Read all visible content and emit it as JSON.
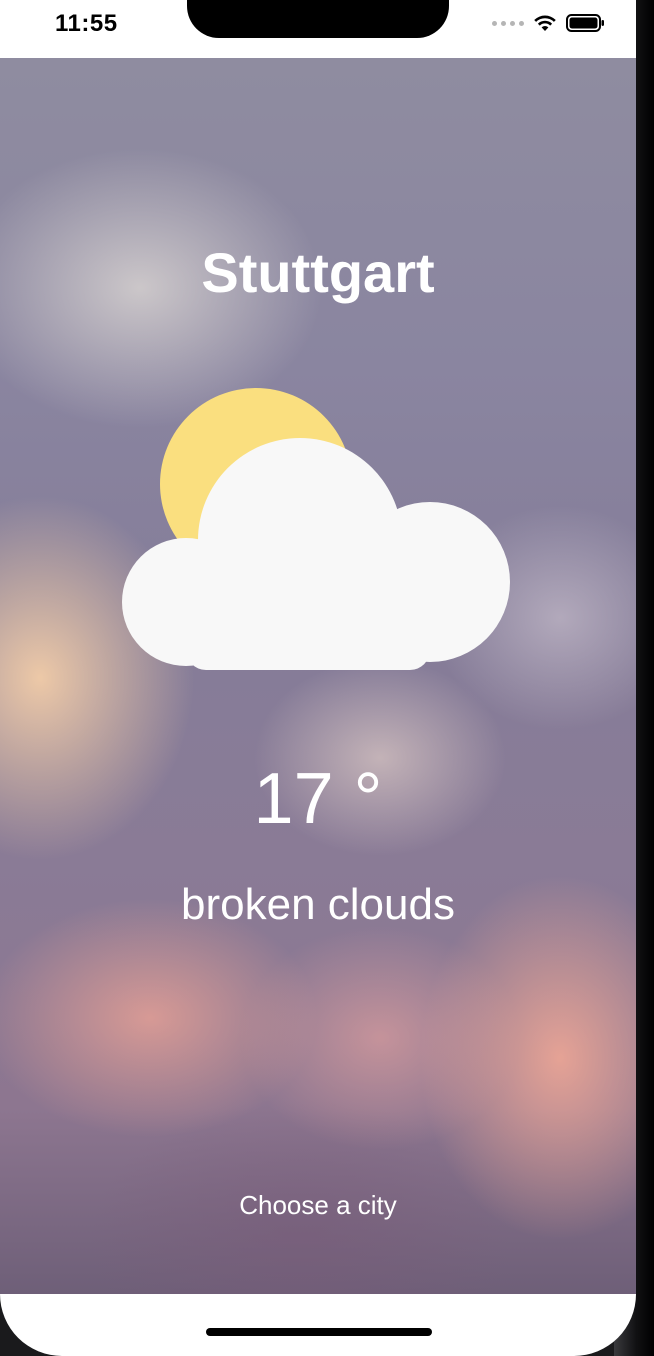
{
  "status_bar": {
    "time": "11:55"
  },
  "weather": {
    "city": "Stuttgart",
    "temperature": "17 °",
    "description": "broken clouds",
    "icon": "partly-cloudy-icon"
  },
  "footer": {
    "choose_city_label": "Choose a city"
  },
  "colors": {
    "sun": "#FADF7F",
    "cloud": "#F8F8F8",
    "text": "#FFFFFF"
  }
}
